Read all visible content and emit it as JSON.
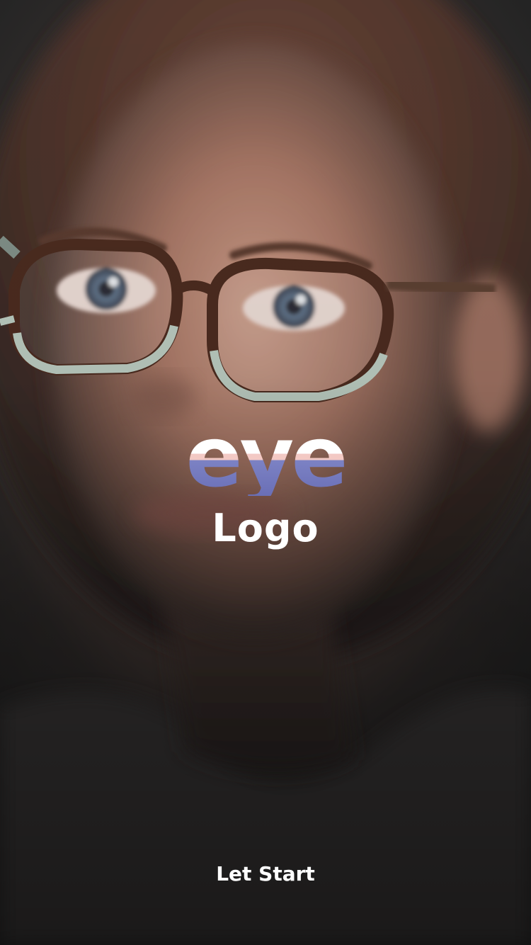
{
  "logo": {
    "word": "eye",
    "subtitle": "Logo",
    "colors": {
      "top": "#ffffff",
      "band": "#f3c9c4",
      "bottom": "#6a6fb6"
    }
  },
  "actions": {
    "start_label": "Let Start"
  },
  "background": {
    "description_icon": "portrait-photo",
    "tint": "#2a2a2a"
  }
}
